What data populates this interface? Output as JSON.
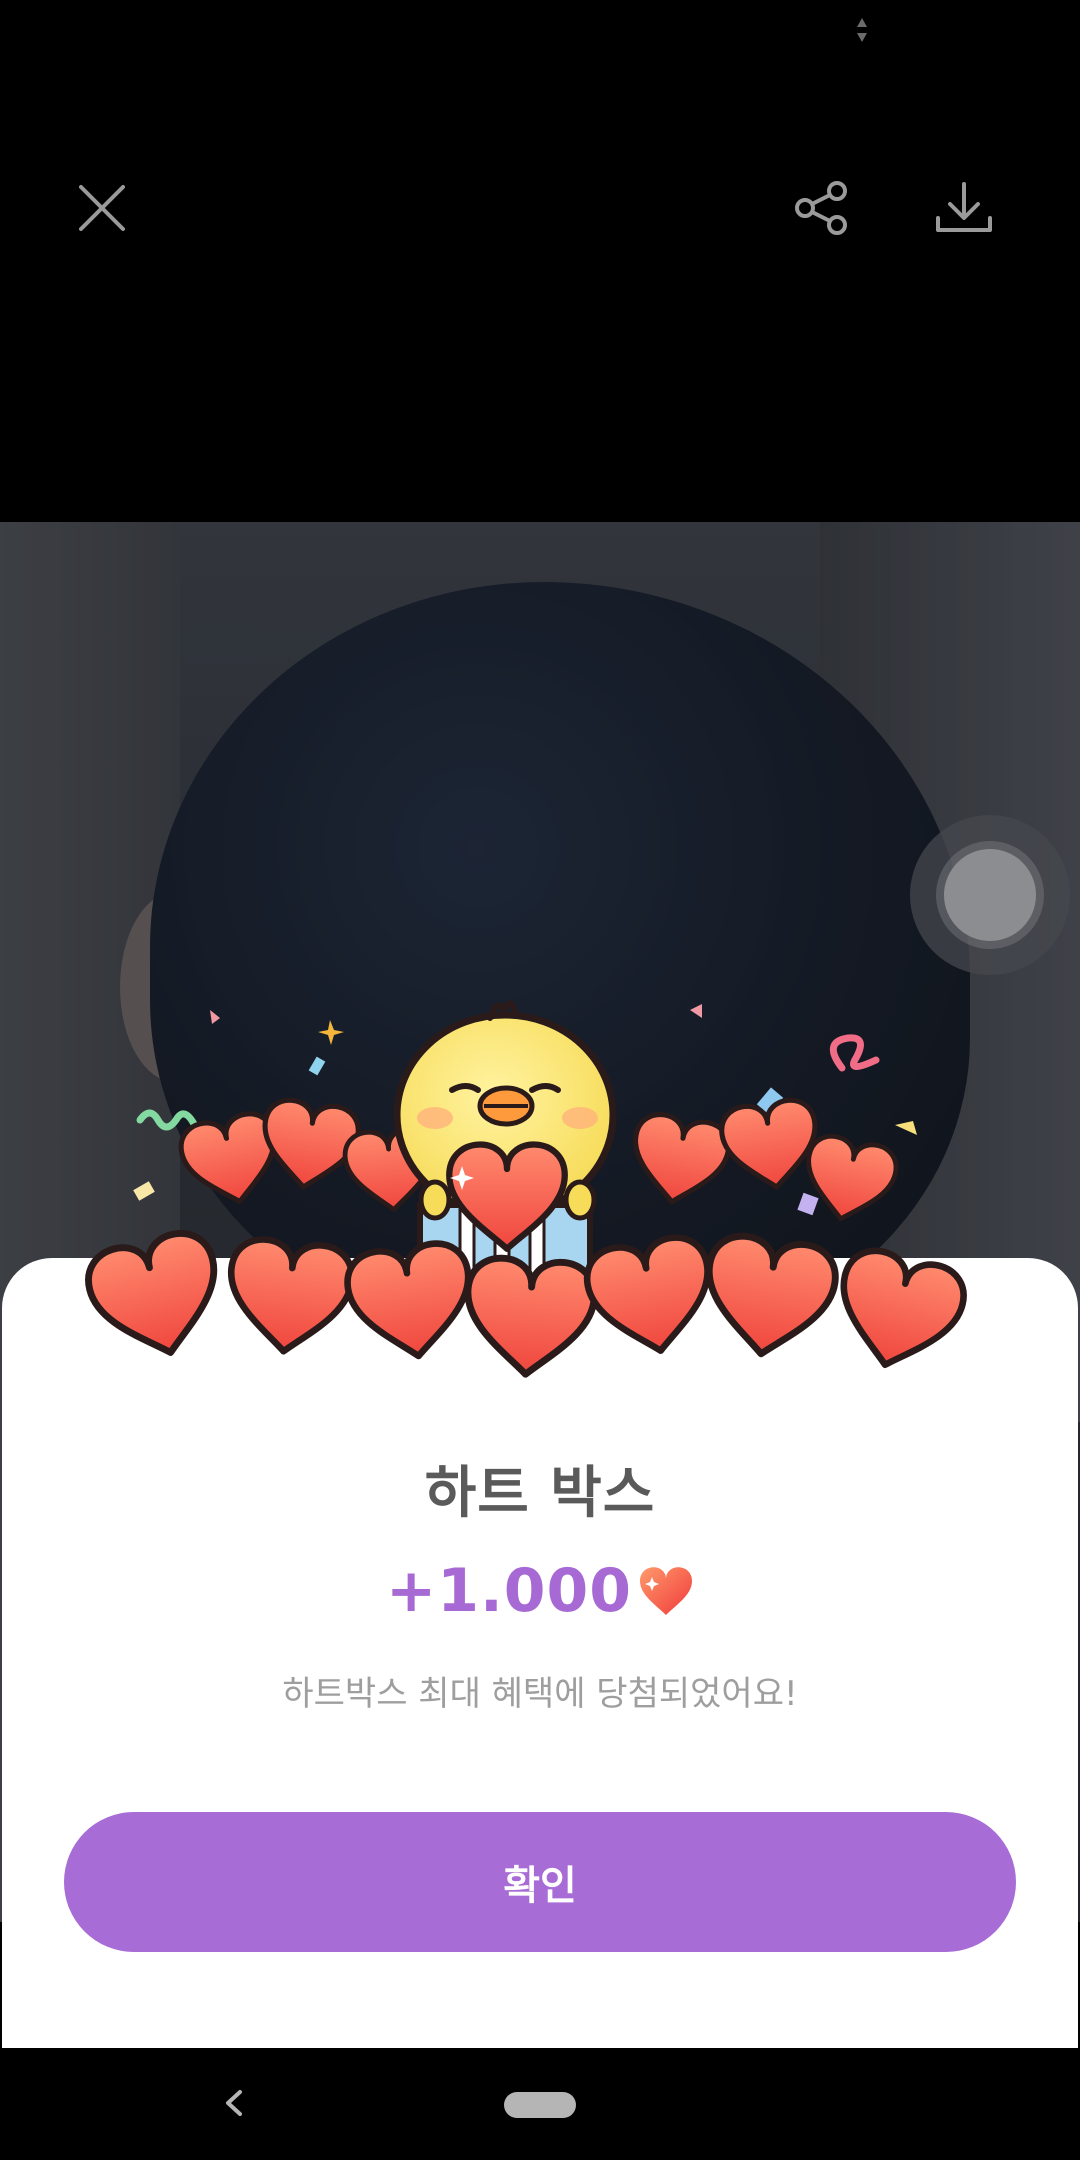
{
  "topbar": {
    "close_icon": "close-icon",
    "share_icon": "share-icon",
    "download_icon": "download-icon"
  },
  "popup": {
    "title": "하트 박스",
    "amount": "+1.000",
    "description": "하트박스 최대 혜택에 당첨되었어요!",
    "confirm_label": "확인",
    "accent_color": "#a86cd6",
    "heart_icon": "heart-icon"
  },
  "navbar": {
    "back_icon": "back-chevron-icon",
    "home_icon": "home-pill-icon"
  }
}
